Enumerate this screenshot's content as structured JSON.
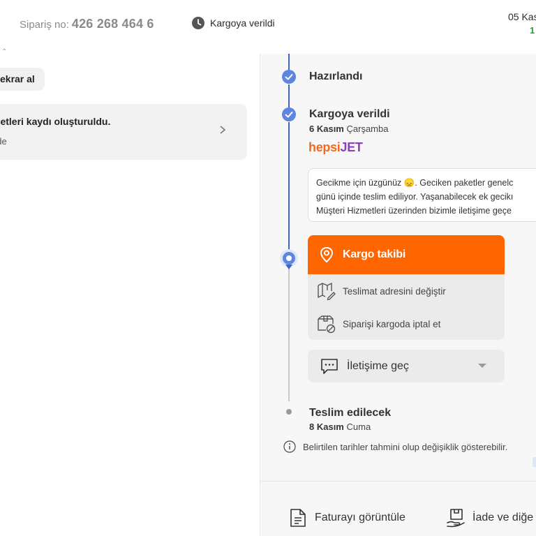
{
  "header": {
    "order_label": "Sipariş no:",
    "order_number": "426 268 464 6",
    "status_label": "Kargoya verildi",
    "date_label": "05 Kas",
    "date_sub": "1"
  },
  "left": {
    "buy_again_label": "ekrar al",
    "notice_title": "metleri kaydı oluşturuldu.",
    "notice_sub": "nde"
  },
  "timeline": {
    "steps": [
      {
        "title": "Hazırlandı",
        "state": "done"
      },
      {
        "title": "Kargoya verildi",
        "date_bold": "6 Kasım",
        "date_rest": "Çarşamba",
        "state": "done"
      },
      {
        "title": "Teslim edilecek",
        "date_bold": "8 Kasım",
        "date_rest": "Cuma",
        "state": "pending"
      }
    ],
    "carrier_brand": {
      "part1": "hepsi",
      "part2": "JET"
    },
    "delay_message": [
      "Gecikme için üzgünüz 😞. Geciken paketler genelc",
      "günü içinde teslim ediliyor. Yaşanabilecek ek gecikı",
      "Müşteri Hizmetleri üzerinden bizimle iletişime geçe"
    ]
  },
  "actions": {
    "track_label": "Kargo takibi",
    "change_address_label": "Teslimat adresini değiştir",
    "cancel_label": "Siparişi kargoda iptal et",
    "contact_label": "İletişime geç"
  },
  "info_note": "Belirtilen tarihler tahmini olup değişiklik gösterebilir.",
  "footer": {
    "invoice_label": "Faturayı görüntüle",
    "return_label": "İade ve diğe"
  },
  "colors": {
    "accent_orange": "#ff6600",
    "timeline_blue": "#3f63c7",
    "dot_blue": "#5e86e0",
    "success_green": "#2e9c3a",
    "brand_orange": "#f06a1d",
    "brand_purple": "#8a3fbf"
  },
  "icons": {
    "status": "clock-icon",
    "track": "location-pin-icon",
    "change_address": "map-edit-icon",
    "cancel": "box-cancel-icon",
    "contact": "chat-bubble-icon",
    "info": "info-icon",
    "invoice": "document-icon",
    "return": "return-box-icon"
  }
}
